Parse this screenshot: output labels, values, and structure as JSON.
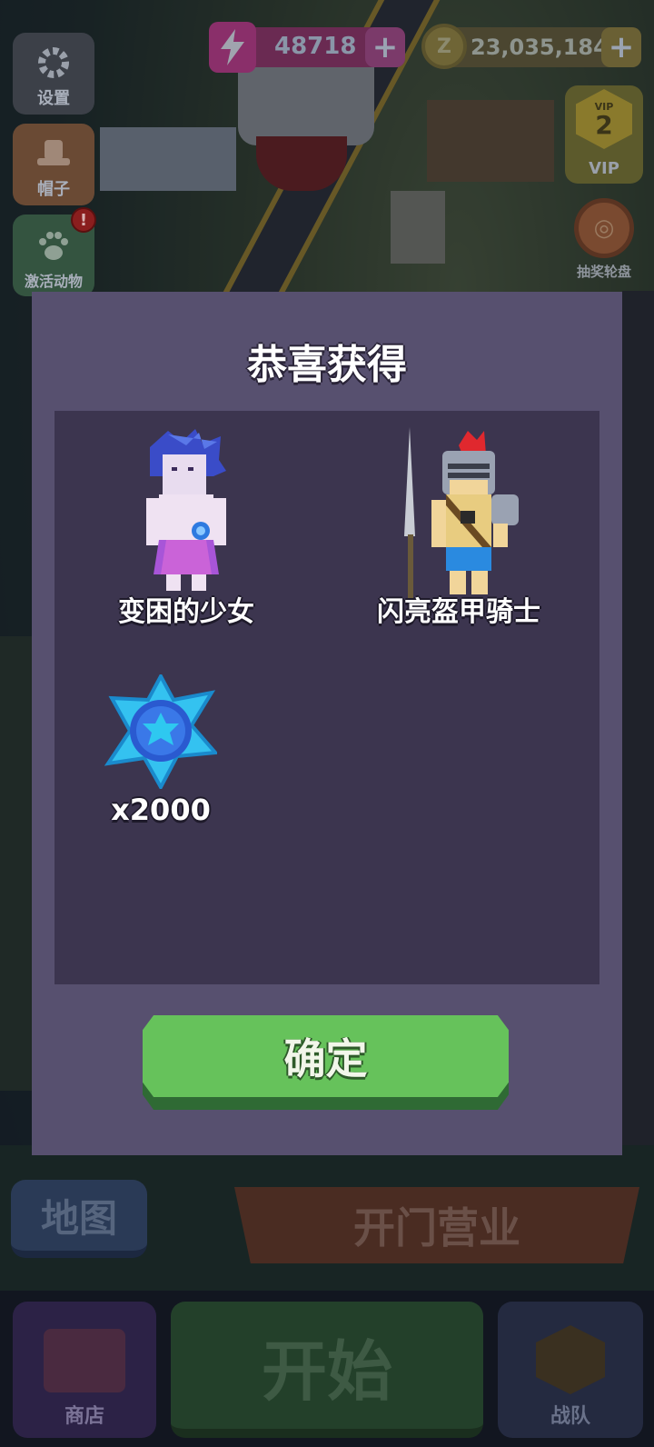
{
  "hud": {
    "energy_value": "48718",
    "coin_symbol": "Z",
    "coin_value": "23,035,184",
    "plus_label": "+"
  },
  "side_buttons": {
    "settings": "设置",
    "hat": "帽子",
    "pets": "激活动物",
    "pets_badge": "!",
    "vip_small": "VIP",
    "vip_level": "2",
    "vip_label": "VIP",
    "wheel": "抽奖轮盘"
  },
  "modal": {
    "title": "恭喜获得",
    "rewards": [
      {
        "name": "变困的少女",
        "icon": "girl-character-icon"
      },
      {
        "name": "闪亮盔甲骑士",
        "icon": "knight-character-icon"
      },
      {
        "name": "x2000",
        "icon": "blue-star-token-icon"
      }
    ],
    "confirm_label": "确定"
  },
  "bottom": {
    "map": "地图",
    "open_business": "开门营业",
    "shop": "商店",
    "start": "开始",
    "team": "战队"
  },
  "colors": {
    "modal_bg": "#57506f",
    "panel_bg": "#3c354f",
    "confirm_green": "#66c25b"
  }
}
